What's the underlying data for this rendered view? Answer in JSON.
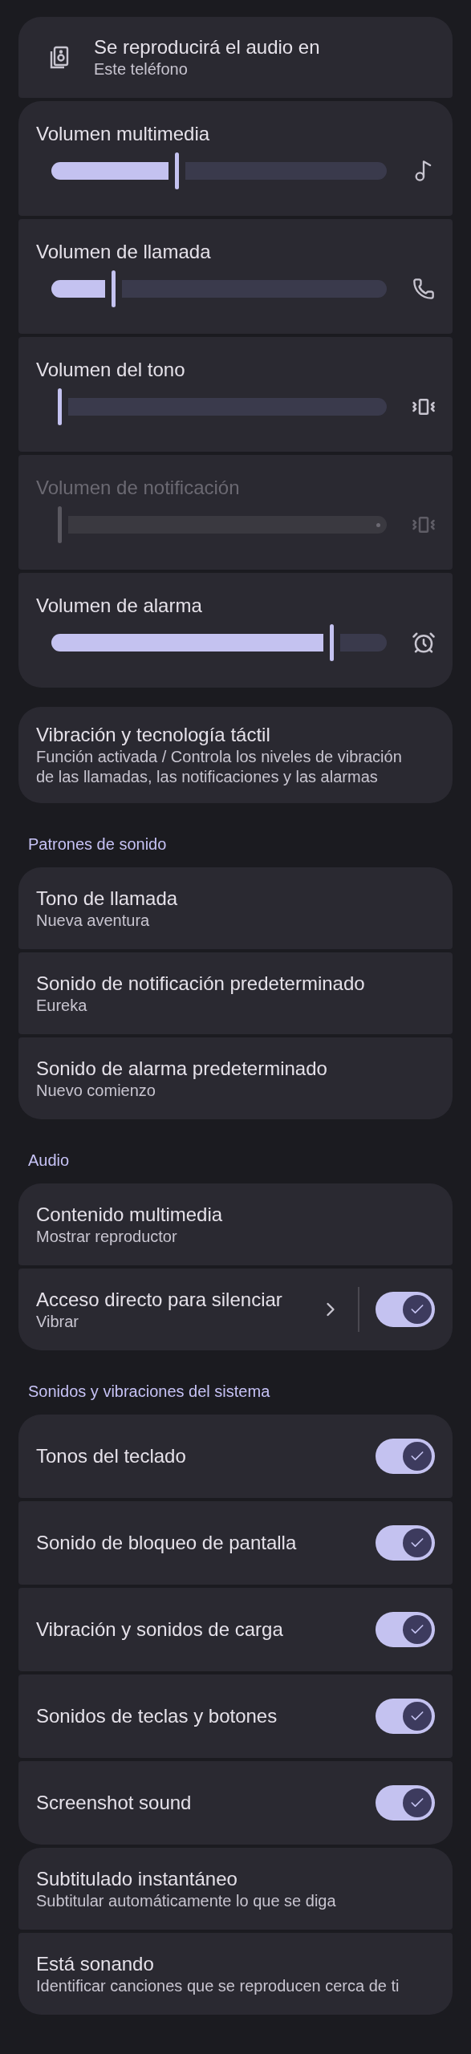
{
  "output": {
    "title": "Se reproducirá el audio en",
    "subtitle": "Este teléfono"
  },
  "volumes": [
    {
      "label": "Volumen multimedia",
      "level": 0.35,
      "disabled": false
    },
    {
      "label": "Volumen de llamada",
      "level": 0.16,
      "disabled": false
    },
    {
      "label": "Volumen del tono",
      "level": 0.0,
      "disabled": false
    },
    {
      "label": "Volumen de notificación",
      "level": 0.0,
      "disabled": true
    },
    {
      "label": "Volumen de alarma",
      "level": 0.81,
      "disabled": false
    }
  ],
  "vibration": {
    "title": "Vibración y tecnología táctil",
    "subtitle": "Función activada / Controla los niveles de vibración de las llamadas, las notificaciones y las alarmas"
  },
  "sections": [
    {
      "header": "Patrones de sonido",
      "items": [
        {
          "title": "Tono de llamada",
          "subtitle": "Nueva aventura"
        },
        {
          "title": "Sonido de notificación predeterminado",
          "subtitle": "Eureka"
        },
        {
          "title": "Sonido de alarma predeterminado",
          "subtitle": "Nuevo comienzo"
        }
      ]
    },
    {
      "header": "Audio",
      "items": [
        {
          "title": "Contenido multimedia",
          "subtitle": "Mostrar reproductor"
        },
        {
          "title": "Acceso directo para silenciar",
          "subtitle": "Vibrar",
          "on": true
        }
      ]
    },
    {
      "header": "Sonidos y vibraciones del sistema",
      "items": [
        {
          "title": "Tonos del teclado",
          "on": true
        },
        {
          "title": "Sonido de bloqueo de pantalla",
          "on": true
        },
        {
          "title": "Vibración y sonidos de carga",
          "on": true
        },
        {
          "title": "Sonidos de teclas y botones",
          "on": true
        },
        {
          "title": "Screenshot sound",
          "on": true
        }
      ]
    }
  ],
  "extras": [
    {
      "title": "Subtitulado instantáneo",
      "subtitle": "Subtitular automáticamente lo que se diga"
    },
    {
      "title": "Está sonando",
      "subtitle": "Identificar canciones que se reproducen cerca de ti"
    }
  ]
}
